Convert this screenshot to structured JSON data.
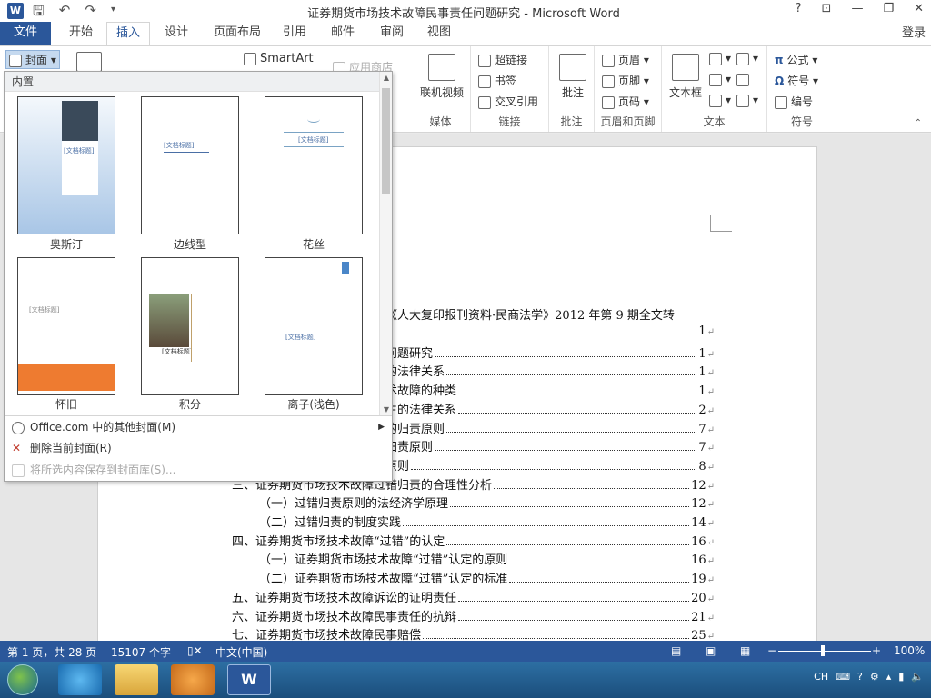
{
  "app": {
    "logo": "W",
    "title": "证券期货市场技术故障民事责任问题研究 - Microsoft Word"
  },
  "qat": {
    "save_icon": "save-icon",
    "undo_icon": "undo-icon",
    "redo_icon": "redo-icon",
    "customize_icon": "customize-qat-icon"
  },
  "window_controls": {
    "help": "?",
    "restore_ribbon": "⊡",
    "minimize": "—",
    "maximize": "❐",
    "close": "✕"
  },
  "tabs": [
    {
      "label": "文件"
    },
    {
      "label": "开始"
    },
    {
      "label": "插入"
    },
    {
      "label": "设计"
    },
    {
      "label": "页面布局"
    },
    {
      "label": "引用"
    },
    {
      "label": "邮件"
    },
    {
      "label": "审阅"
    },
    {
      "label": "视图"
    }
  ],
  "signin": "登录",
  "ribbon": {
    "cover_button": "封面",
    "smartart": "SmartArt",
    "app_store": "应用商店",
    "media": {
      "online_video": "联机视频",
      "group": "媒体"
    },
    "links": {
      "hyperlink": "超链接",
      "bookmark": "书签",
      "cross_ref": "交叉引用",
      "group": "链接"
    },
    "comments": {
      "comment": "批注",
      "group": "批注"
    },
    "header_footer": {
      "header": "页眉",
      "footer": "页脚",
      "page_number": "页码",
      "group": "页眉和页脚"
    },
    "text": {
      "textbox": "文本框",
      "group": "文本"
    },
    "symbols": {
      "equation": "公式",
      "symbol": "符号",
      "number": "编号",
      "group": "符号"
    }
  },
  "cover_panel": {
    "header": "内置",
    "templates": [
      {
        "label": "奥斯汀",
        "title": "[文档标题]"
      },
      {
        "label": "边线型",
        "title": "[文档标题]"
      },
      {
        "label": "花丝",
        "title": "[文档标题]"
      },
      {
        "label": "怀旧",
        "title": "[文档标题]"
      },
      {
        "label": "积分",
        "title": "[文档标题]"
      },
      {
        "label": "离子(浅色)",
        "title": "[文档标题]"
      }
    ],
    "menu": [
      {
        "label": "Office.com 中的其他封面(M)",
        "enabled": true
      },
      {
        "label": "删除当前封面(R)",
        "enabled": true
      },
      {
        "label": "将所选内容保存到封面库(S)...",
        "enabled": false
      }
    ]
  },
  "document": {
    "source_line": "《人大复印报刊资料·民商法学》2012 年第 9 期全文转",
    "toc": [
      {
        "text": "",
        "page": "1"
      },
      {
        "text": "问题研究",
        "page": "1"
      },
      {
        "text": "的法律关系",
        "page": "1"
      },
      {
        "text": "术故障的种类",
        "page": "1"
      },
      {
        "text": "生的法律关系",
        "page": "2"
      },
      {
        "text": "的归责原则",
        "page": "7"
      },
      {
        "text": "归责原则",
        "page": "7"
      },
      {
        "text": "原则",
        "page": "8"
      },
      {
        "text": "三、证券期货市场技术故障过错归责的合理性分析",
        "page": "12"
      },
      {
        "text": "（一）过错归责原则的法经济学原理",
        "page": "12"
      },
      {
        "text": "（二）过错归责的制度实践",
        "page": "14"
      },
      {
        "text": "四、证券期货市场技术故障“过错”的认定",
        "page": "16"
      },
      {
        "text": "（一）证券期货市场技术故障“过错”认定的原则",
        "page": "16"
      },
      {
        "text": "（二）证券期货市场技术故障“过错”认定的标准",
        "page": "19"
      },
      {
        "text": "五、证券期货市场技术故障诉讼的证明责任",
        "page": "20"
      },
      {
        "text": "六、证券期货市场技术故障民事责任的抗辩",
        "page": "21"
      },
      {
        "text": "七、证券期货市场技术故障民事赔偿",
        "page": "25"
      }
    ]
  },
  "status": {
    "page_info": "第 1 页，共 28 页",
    "word_count": "15107 个字",
    "language": "中文(中国)",
    "zoom": "100%",
    "zoom_level": 1.0
  },
  "taskbar": {
    "ime": "CH"
  },
  "colors": {
    "accent": "#2b579a"
  }
}
